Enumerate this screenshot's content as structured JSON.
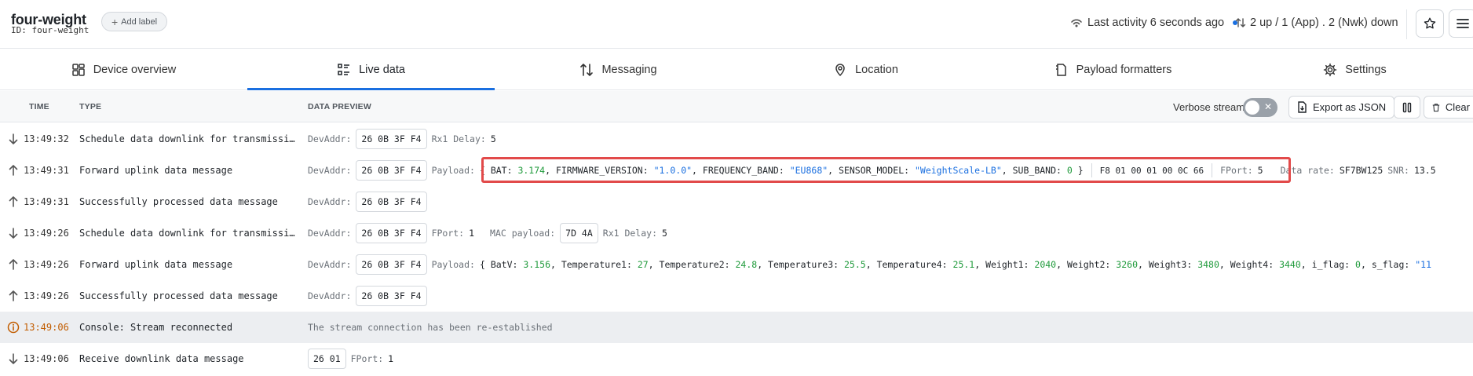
{
  "header": {
    "device_name": "four-weight",
    "device_id": "ID: four-weight",
    "add_label": "Add label",
    "last_activity": "Last activity 6 seconds ago",
    "updown": "2 up / 1 (App) . 2 (Nwk) down"
  },
  "tabs": [
    {
      "label": "Device overview",
      "icon": "grid-icon"
    },
    {
      "label": "Live data",
      "icon": "list-icon"
    },
    {
      "label": "Messaging",
      "icon": "up-down-arrows-icon"
    },
    {
      "label": "Location",
      "icon": "map-pin-icon"
    },
    {
      "label": "Payload formatters",
      "icon": "code-doc-icon"
    },
    {
      "label": "Settings",
      "icon": "gear-icon"
    }
  ],
  "active_tab": "Live data",
  "toolbar": {
    "col_time": "TIME",
    "col_type": "TYPE",
    "col_preview": "DATA PREVIEW",
    "verbose": "Verbose stream",
    "export": "Export as JSON",
    "clear": "Clear"
  },
  "rows": [
    {
      "dir": "down",
      "time": "13:49:32",
      "type": "Schedule data downlink for transmission",
      "devaddr_label": "DevAddr:",
      "devaddr": "26 0B 3F F4",
      "extra": "Rx1 Delay:",
      "extra_val": "5"
    },
    {
      "dir": "up",
      "time": "13:49:31",
      "type": "Forward uplink data message",
      "devaddr_label": "DevAddr:",
      "devaddr": "26 0B 3F F4",
      "payload_label": "Payload:",
      "payload": {
        "bat_key": "BAT:",
        "bat": "3.174",
        "fw_key": "FIRMWARE_VERSION:",
        "fw": "\"1.0.0\"",
        "fb_key": "FREQUENCY_BAND:",
        "fb": "\"EU868\"",
        "sm_key": "SENSOR_MODEL:",
        "sm": "\"WeightScale-LB\"",
        "sb_key": "SUB_BAND:",
        "sb": "0"
      },
      "hex": "F8 01 00 01 00 0C 66",
      "fport_label": "FPort:",
      "fport": "5",
      "datarate_label": "Data rate:",
      "datarate": "SF7BW125",
      "snr_label": "SNR:",
      "snr": "13.5"
    },
    {
      "dir": "up",
      "time": "13:49:31",
      "type": "Successfully processed data message",
      "devaddr_label": "DevAddr:",
      "devaddr": "26 0B 3F F4"
    },
    {
      "dir": "down",
      "time": "13:49:26",
      "type": "Schedule data downlink for transmission",
      "devaddr_label": "DevAddr:",
      "devaddr": "26 0B 3F F4",
      "fport_label": "FPort:",
      "fport": "1",
      "mac_label": "MAC payload:",
      "mac": "7D 4A",
      "extra": "Rx1 Delay:",
      "extra_val": "5"
    },
    {
      "dir": "up",
      "time": "13:49:26",
      "type": "Forward uplink data message",
      "devaddr_label": "DevAddr:",
      "devaddr": "26 0B 3F F4",
      "payload_label": "Payload:",
      "payload2": {
        "k1": "BatV:",
        "v1": "3.156",
        "k2": "Temperature1:",
        "v2": "27",
        "k3": "Temperature2:",
        "v3": "24.8",
        "k4": "Temperature3:",
        "v4": "25.5",
        "k5": "Temperature4:",
        "v5": "25.1",
        "k6": "Weight1:",
        "v6": "2040",
        "k7": "Weight2:",
        "v7": "3260",
        "k8": "Weight3:",
        "v8": "3480",
        "k9": "Weight4:",
        "v9": "3440",
        "k10": "i_flag:",
        "v10": "0",
        "k11": "s_flag:",
        "v11": "\"11"
      }
    },
    {
      "dir": "up",
      "time": "13:49:26",
      "type": "Successfully processed data message",
      "devaddr_label": "DevAddr:",
      "devaddr": "26 0B 3F F4"
    },
    {
      "dir": "info",
      "time": "13:49:06",
      "type": "Console: Stream reconnected",
      "message": "The stream connection has been re-established"
    },
    {
      "dir": "down",
      "time": "13:49:06",
      "type": "Receive downlink data message",
      "chip": "26 01",
      "fport_label": "FPort:",
      "fport": "1"
    }
  ]
}
